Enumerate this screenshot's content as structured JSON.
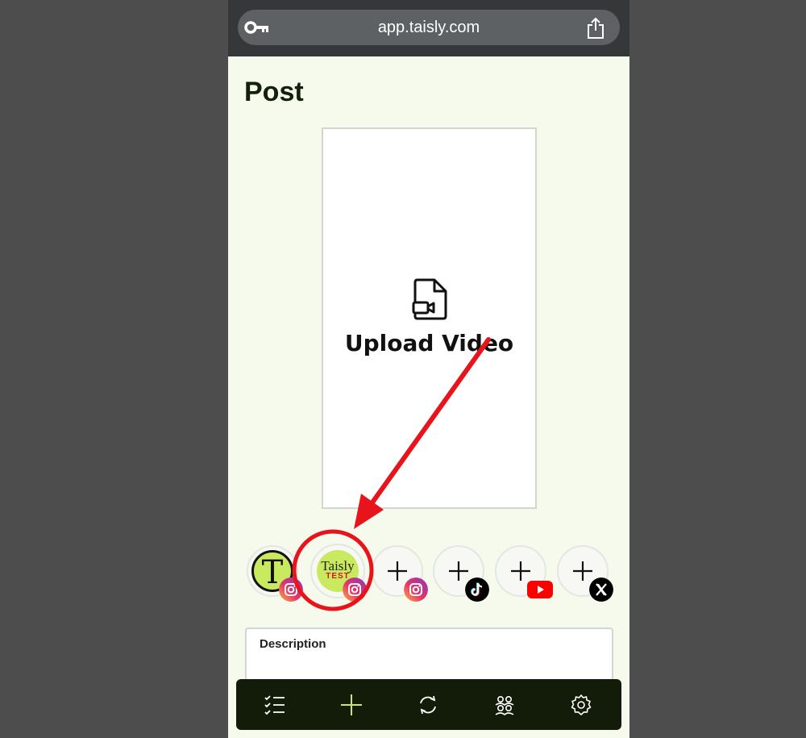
{
  "browser": {
    "url": "app.taisly.com"
  },
  "page": {
    "title": "Post"
  },
  "upload": {
    "label": "Upload Video"
  },
  "accounts": [
    {
      "avatar_text": "T",
      "network": "instagram",
      "connected": true
    },
    {
      "avatar_text_1": "Taisly",
      "avatar_text_2": "TEST",
      "network": "instagram",
      "connected": true,
      "selected": true
    },
    {
      "network": "instagram",
      "connected": false
    },
    {
      "network": "tiktok",
      "connected": false
    },
    {
      "network": "youtube",
      "connected": false
    },
    {
      "network": "x",
      "connected": false
    }
  ],
  "description": {
    "label": "Description"
  },
  "tab_bar": {
    "items": [
      "checklist-icon",
      "plus-icon",
      "refresh-icon",
      "group-icon",
      "gear-icon"
    ]
  },
  "colors": {
    "accent": "#c9ea5e",
    "background": "#f6faec",
    "tab_bar": "#131c08",
    "annotation": "#e8141c"
  }
}
